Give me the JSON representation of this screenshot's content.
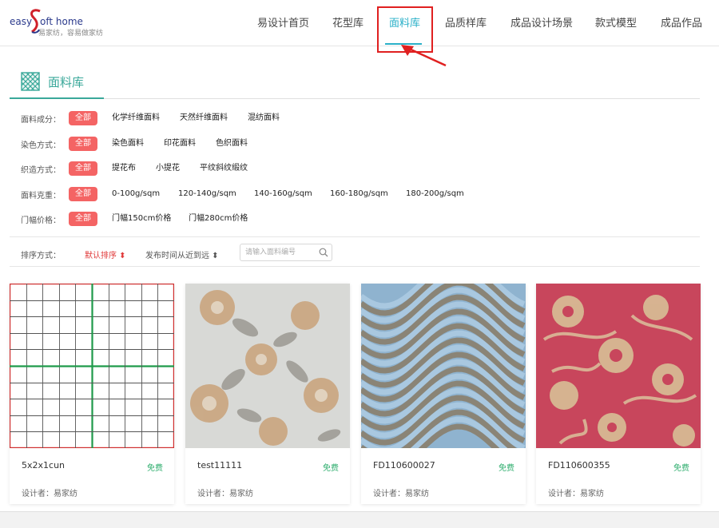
{
  "logo": {
    "easy": "easy",
    "brand": "oft home",
    "slogan": "易家纺，容易做家纺"
  },
  "nav": {
    "items": [
      {
        "label": "易设计首页"
      },
      {
        "label": "花型库"
      },
      {
        "label": "面料库",
        "active": true
      },
      {
        "label": "品质样库"
      },
      {
        "label": "成品设计场景"
      },
      {
        "label": "款式模型"
      },
      {
        "label": "成品作品"
      }
    ]
  },
  "section": {
    "title": "面料库",
    "icon": "lattice-icon"
  },
  "filters": [
    {
      "label": "面料成分：",
      "options": [
        "全部",
        "化学纤维面料",
        "天然纤维面料",
        "混纺面料"
      ]
    },
    {
      "label": "染色方式：",
      "options": [
        "全部",
        "染色面料",
        "印花面料",
        "色织面料"
      ]
    },
    {
      "label": "织造方式：",
      "options": [
        "全部",
        "提花布",
        "小提花",
        "平纹斜纹缎纹"
      ]
    },
    {
      "label": "面料克重：",
      "options": [
        "全部",
        "0-100g/sqm",
        "120-140g/sqm",
        "140-160g/sqm",
        "160-180g/sqm",
        "180-200g/sqm"
      ]
    },
    {
      "label": "门幅价格：",
      "options": [
        "全部",
        "门幅150cm价格",
        "门幅280cm价格"
      ]
    }
  ],
  "sort": {
    "label": "排序方式：",
    "default": "默认排序 ⬍",
    "time": "发布时间从近到远 ⬍",
    "search_placeholder": "请输入面料编号"
  },
  "cards": [
    {
      "name": "5x2x1cun",
      "price": "免费",
      "designer": "设计者：易家纺"
    },
    {
      "name": "test11111",
      "price": "免费",
      "designer": "设计者：易家纺"
    },
    {
      "name": "FD110600027",
      "price": "免费",
      "designer": "设计者：易家纺"
    },
    {
      "name": "FD110600355",
      "price": "免费",
      "designer": "设计者：易家纺"
    }
  ],
  "colors": {
    "accent_teal": "#3aa89a",
    "nav_active": "#2ab0c8",
    "chip_red": "#f46464",
    "price_green": "#2fae6e",
    "highlight_red": "#e02020"
  }
}
